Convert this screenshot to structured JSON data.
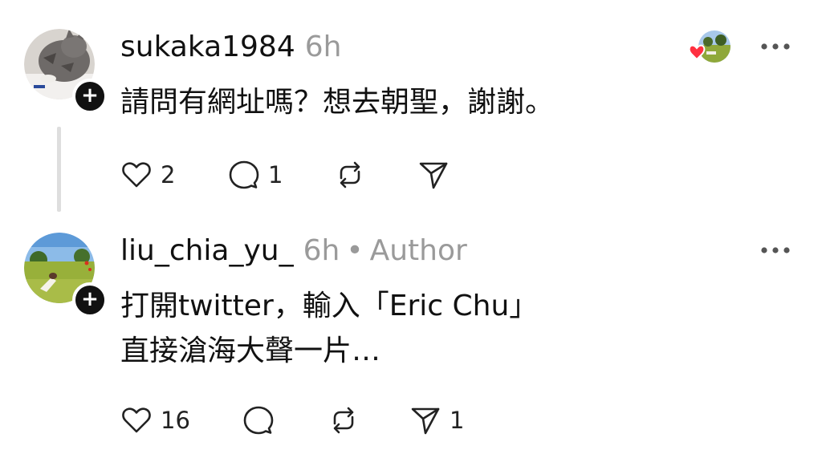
{
  "comments": [
    {
      "username": "sukaka1984",
      "time": "6h",
      "text": "請問有網址嗎？想去朝聖，謝謝。",
      "likes": "2",
      "replies": "1",
      "reposts": "",
      "shares": "",
      "avatar_icon": "cat-avatar",
      "follow_symbol": "+"
    },
    {
      "username": "liu_chia_yu_",
      "time": "6h",
      "dot": "•",
      "author_label": "Author",
      "text_line1": "打開twitter，輸入「Eric Chu」",
      "text_line2": "直接滄海大聲一片…",
      "likes": "16",
      "replies": "",
      "reposts": "",
      "shares": "1",
      "avatar_icon": "field-avatar",
      "follow_symbol": "+"
    }
  ],
  "icons": {
    "like": "heart-icon",
    "reply": "comment-icon",
    "repost": "repost-icon",
    "share": "send-icon",
    "more": "more-dots-icon"
  },
  "colors": {
    "text": "#111111",
    "muted": "#9a9a9a",
    "heart_red": "#ff3040"
  }
}
